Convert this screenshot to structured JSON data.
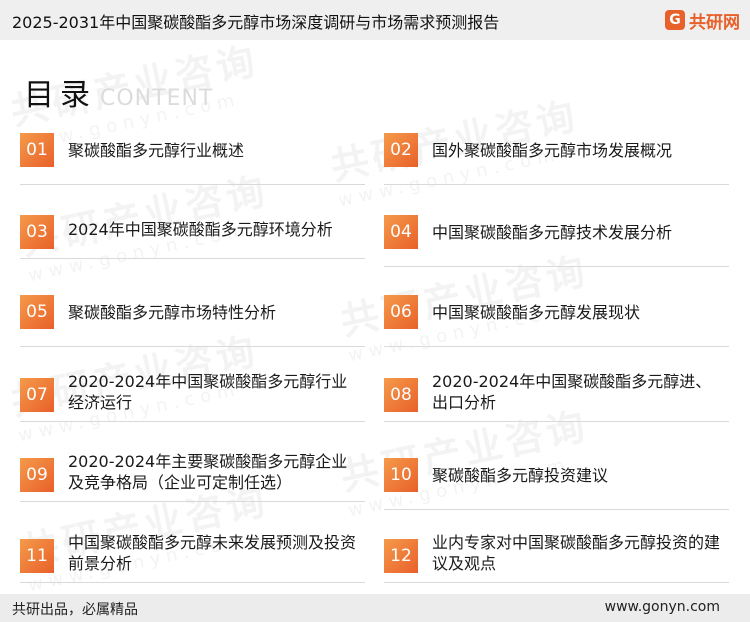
{
  "header": {
    "title": "2025-2031年中国聚碳酸酯多元醇市场深度调研与市场需求预测报告",
    "logo_mark": "G",
    "logo_text": "共研网"
  },
  "heading": {
    "main": "目录",
    "en": "CONTENT"
  },
  "watermark": {
    "text": "共研产业咨询",
    "sub": "www.gonyn.com"
  },
  "toc": [
    {
      "num": "01",
      "label": "聚碳酸酯多元醇行业概述"
    },
    {
      "num": "02",
      "label": "国外聚碳酸酯多元醇市场发展概况"
    },
    {
      "num": "03",
      "label": "2024年中国聚碳酸酯多元醇环境分析"
    },
    {
      "num": "04",
      "label": "中国聚碳酸酯多元醇技术发展分析"
    },
    {
      "num": "05",
      "label": "聚碳酸酯多元醇市场特性分析"
    },
    {
      "num": "06",
      "label": "中国聚碳酸酯多元醇发展现状"
    },
    {
      "num": "07",
      "label": "2020-2024年中国聚碳酸酯多元醇行业经济运行"
    },
    {
      "num": "08",
      "label": "2020-2024年中国聚碳酸酯多元醇进、出口分析"
    },
    {
      "num": "09",
      "label": "2020-2024年主要聚碳酸酯多元醇企业及竞争格局（企业可定制任选）"
    },
    {
      "num": "10",
      "label": "聚碳酸酯多元醇投资建议"
    },
    {
      "num": "11",
      "label": "中国聚碳酸酯多元醇未来发展预测及投资前景分析"
    },
    {
      "num": "12",
      "label": "业内专家对中国聚碳酸酯多元醇投资的建议及观点"
    }
  ],
  "footer": {
    "slogan": "共研出品，必属精品",
    "url": "www.gonyn.com"
  },
  "colors": {
    "accent": "#e8602a",
    "accent_light": "#f59a4a",
    "bar_bg": "#efefef"
  }
}
